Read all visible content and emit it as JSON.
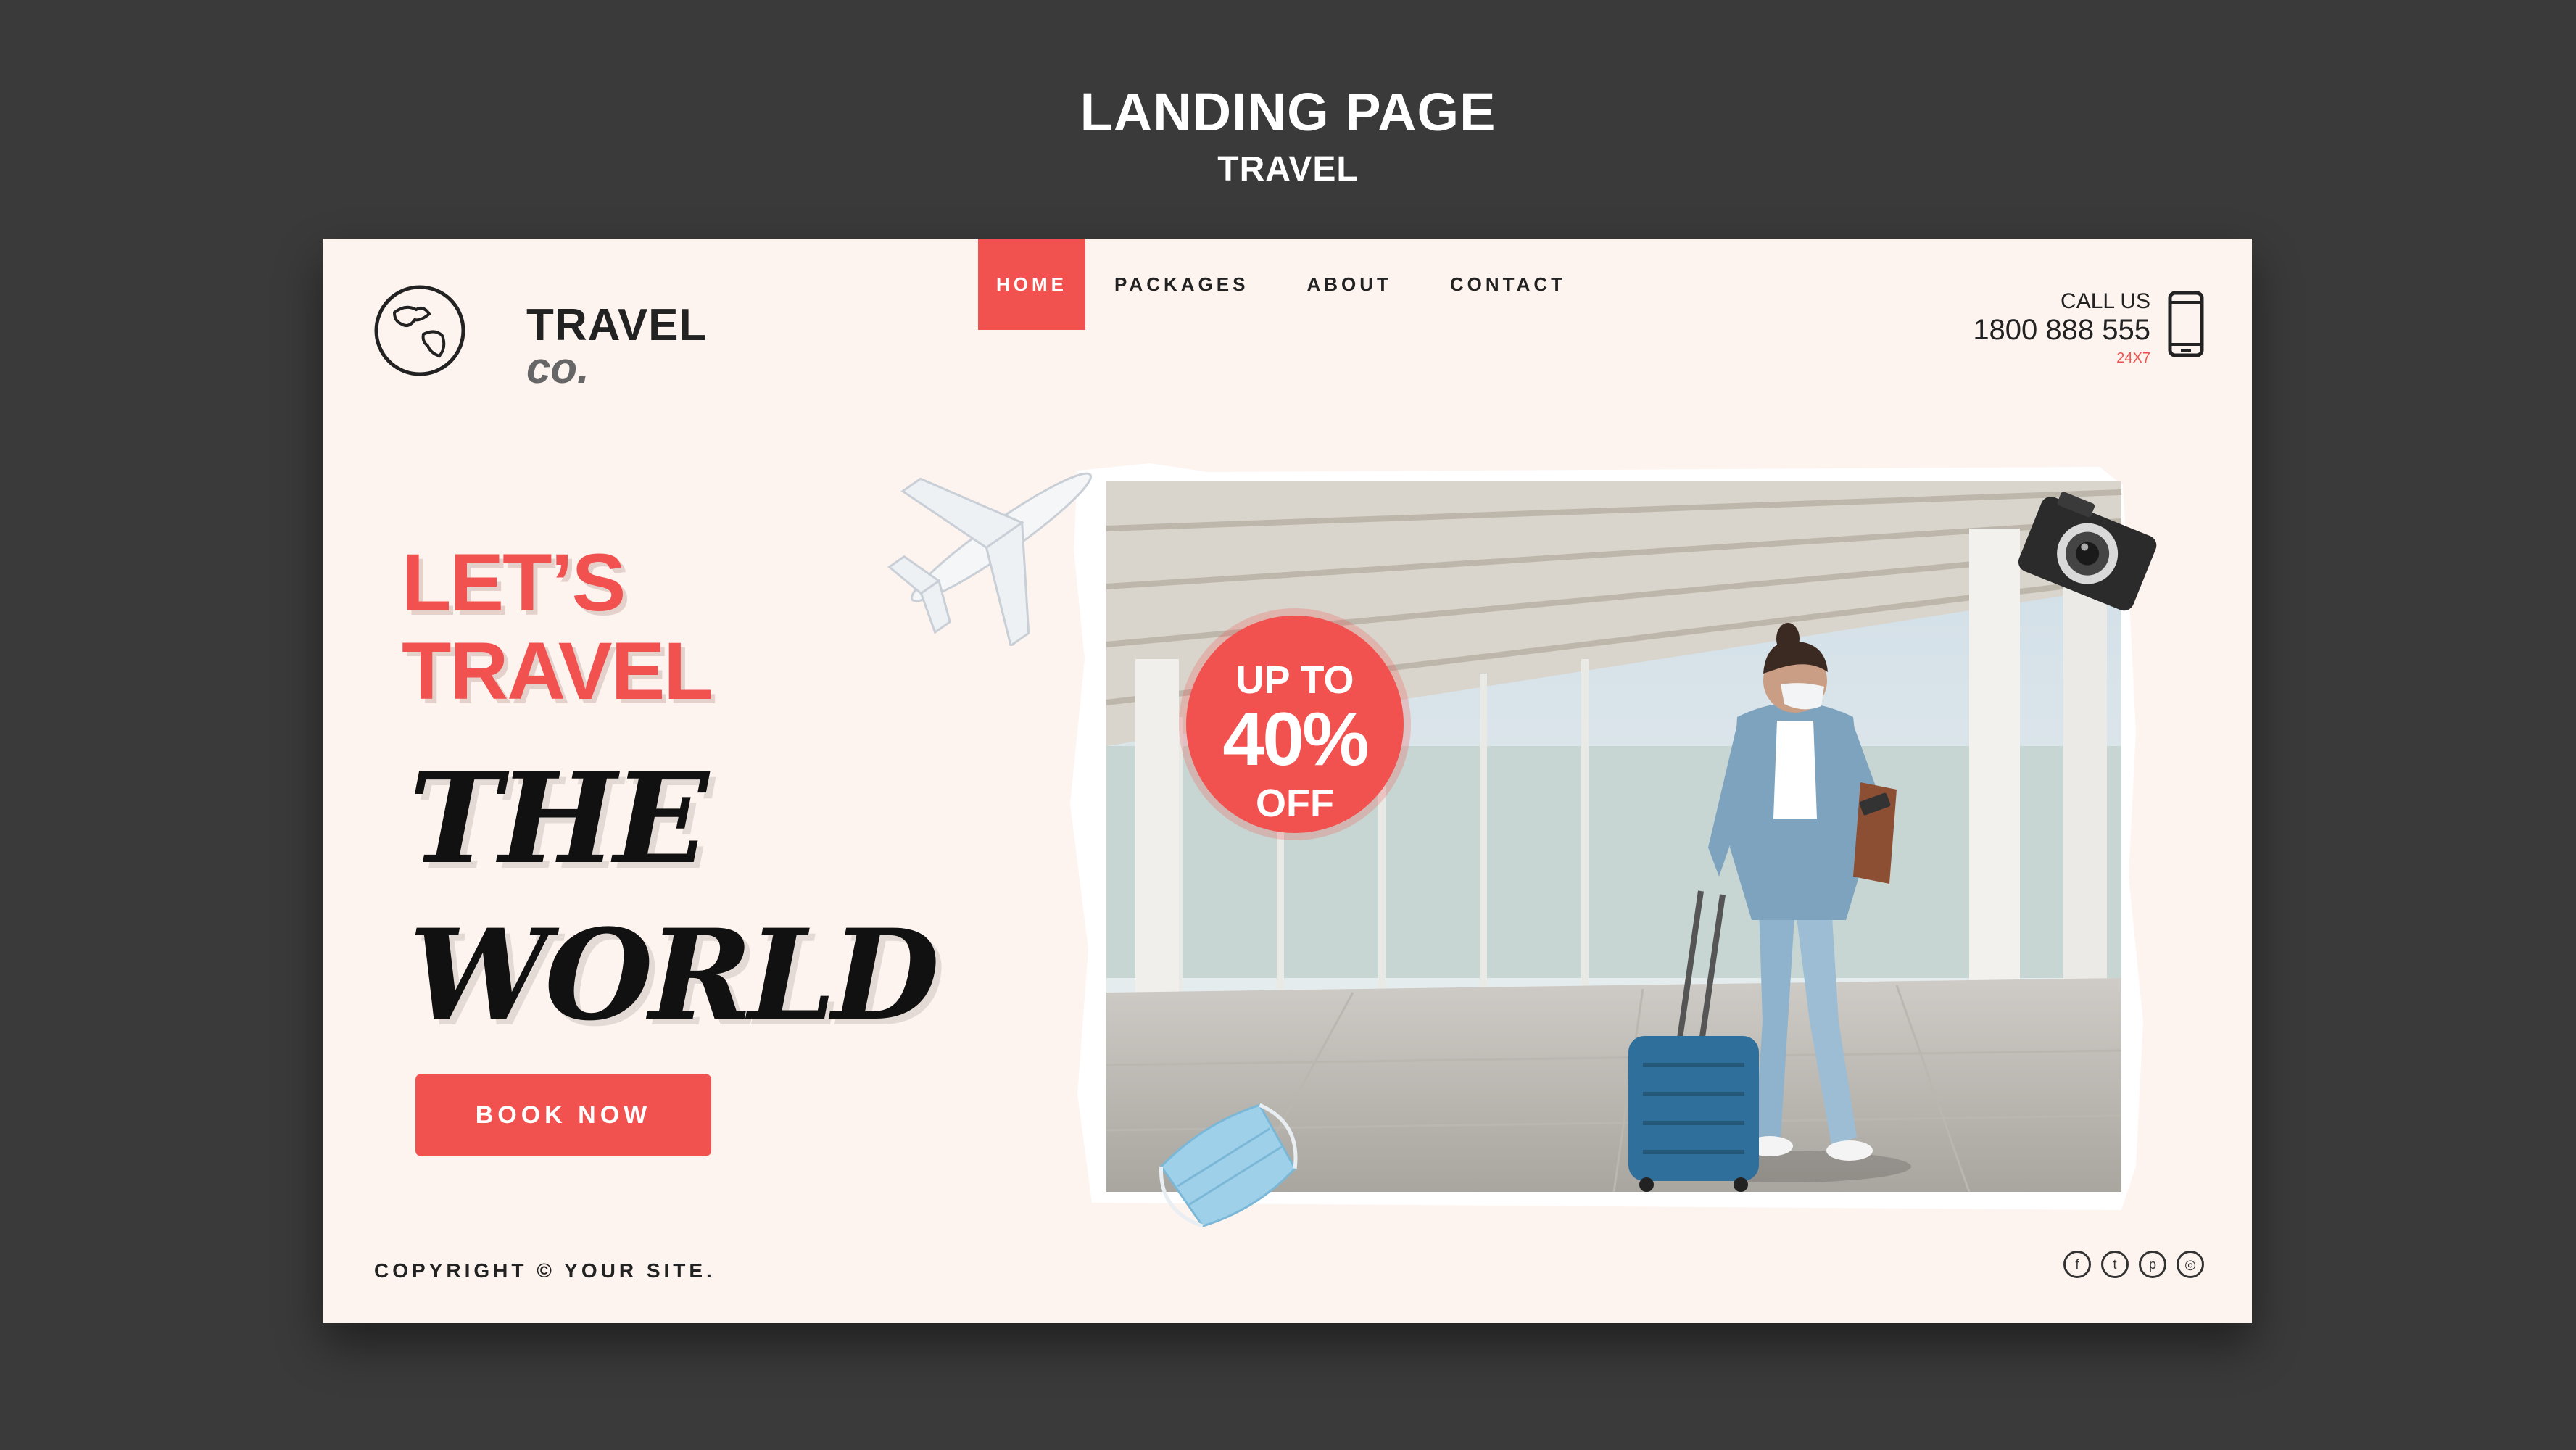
{
  "showcase": {
    "title": "LANDING PAGE",
    "subtitle": "TRAVEL"
  },
  "logo": {
    "line1": "TRAVEL",
    "line2": "co."
  },
  "nav": {
    "items": [
      {
        "label": "HOME",
        "active": true
      },
      {
        "label": "PACKAGES",
        "active": false
      },
      {
        "label": "ABOUT",
        "active": false
      },
      {
        "label": "CONTACT",
        "active": false
      }
    ]
  },
  "contact": {
    "label": "CALL US",
    "number": "1800 888 555",
    "hours": "24X7"
  },
  "hero": {
    "line1": "LET’S",
    "line2": "TRAVEL",
    "line3": "THE",
    "line4": "WORLD",
    "cta": "BOOK NOW"
  },
  "promo": {
    "top": "UP TO",
    "value": "40%",
    "bottom": "OFF"
  },
  "footer": {
    "copyright": "COPYRIGHT © YOUR SITE.",
    "social": [
      {
        "icon": "facebook-icon",
        "glyph": "f"
      },
      {
        "icon": "twitter-icon",
        "glyph": "t"
      },
      {
        "icon": "pinterest-icon",
        "glyph": "p"
      },
      {
        "icon": "instagram-icon",
        "glyph": "◎"
      }
    ]
  },
  "colors": {
    "accent": "#f2524f",
    "page_bg": "#fdf3ef",
    "outer_bg": "#3a3a3a"
  }
}
